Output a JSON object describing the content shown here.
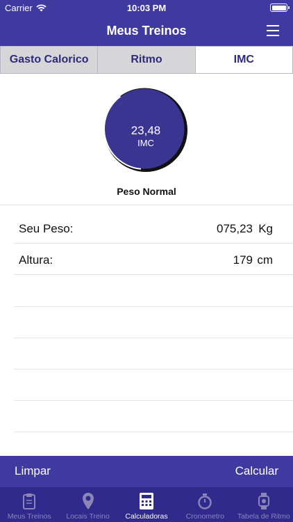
{
  "status_bar": {
    "carrier": "Carrier",
    "time": "10:03 PM"
  },
  "nav": {
    "title": "Meus Treinos"
  },
  "segments": [
    {
      "label": "Gasto Calorico"
    },
    {
      "label": "Ritmo"
    },
    {
      "label": "IMC"
    }
  ],
  "gauge": {
    "value": "23,48",
    "label": "IMC"
  },
  "result": "Peso Normal",
  "fields": [
    {
      "label": "Seu Peso:",
      "value": "075,23",
      "unit": "Kg"
    },
    {
      "label": "Altura:",
      "value": "179",
      "unit": "cm"
    }
  ],
  "actions": {
    "clear": "Limpar",
    "calculate": "Calcular"
  },
  "tabs": [
    {
      "label": "Meus Treinos",
      "icon": "clipboard-icon"
    },
    {
      "label": "Locais Treino",
      "icon": "map-pin-icon"
    },
    {
      "label": "Calculadoras",
      "icon": "calculator-icon"
    },
    {
      "label": "Cronometro",
      "icon": "stopwatch-icon"
    },
    {
      "label": "Tabela de Ritmo",
      "icon": "watch-icon"
    }
  ],
  "colors": {
    "primary": "#3f3aa0",
    "tab_bar": "#2f2a8c",
    "gauge_fill": "#3a3590",
    "gauge_ring": "#111111",
    "segment_inactive": "#d6d6d9"
  }
}
